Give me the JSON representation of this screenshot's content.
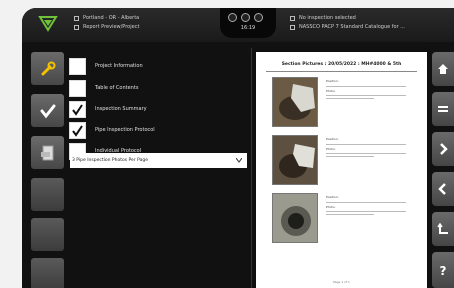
{
  "header": {
    "project_line": "Portland - OR - Alberta",
    "mode_line": "Report Preview/Project",
    "time": "16:19",
    "inspection_line": "No inspection selected",
    "catalogue_line": "NASSCO PACP 7 Standard Catalogue for ..."
  },
  "left_toolbar": {
    "icons": [
      "wrench-icon",
      "checkmark-icon",
      "pdf-document-icon",
      "empty",
      "empty",
      "empty"
    ]
  },
  "options": [
    {
      "label": "Project Information",
      "checked": false
    },
    {
      "label": "Table of Contents",
      "checked": false
    },
    {
      "label": "Inspection Summary",
      "checked": true
    },
    {
      "label": "Pipe Inspection Protocol",
      "checked": true
    },
    {
      "label": "Individual Protocol",
      "checked": false
    }
  ],
  "dropdown": {
    "value": "3 Pipe Inspection Photos Per Page"
  },
  "preview": {
    "heading": "Section Pictures : 20/05/2022 : MH#4000 & 5th",
    "photo_field_1": "Position:",
    "photo_field_2": "Photo:",
    "footer": "Page 1 of 1"
  },
  "right_toolbar": {
    "icons": [
      "home-icon",
      "menu-icon",
      "chevron-right-icon",
      "chevron-left-icon",
      "return-icon",
      "help-icon"
    ]
  },
  "colors": {
    "accent_green": "#6fc23a",
    "device_bg": "#111111",
    "button_gray": "#5a5a5a"
  }
}
